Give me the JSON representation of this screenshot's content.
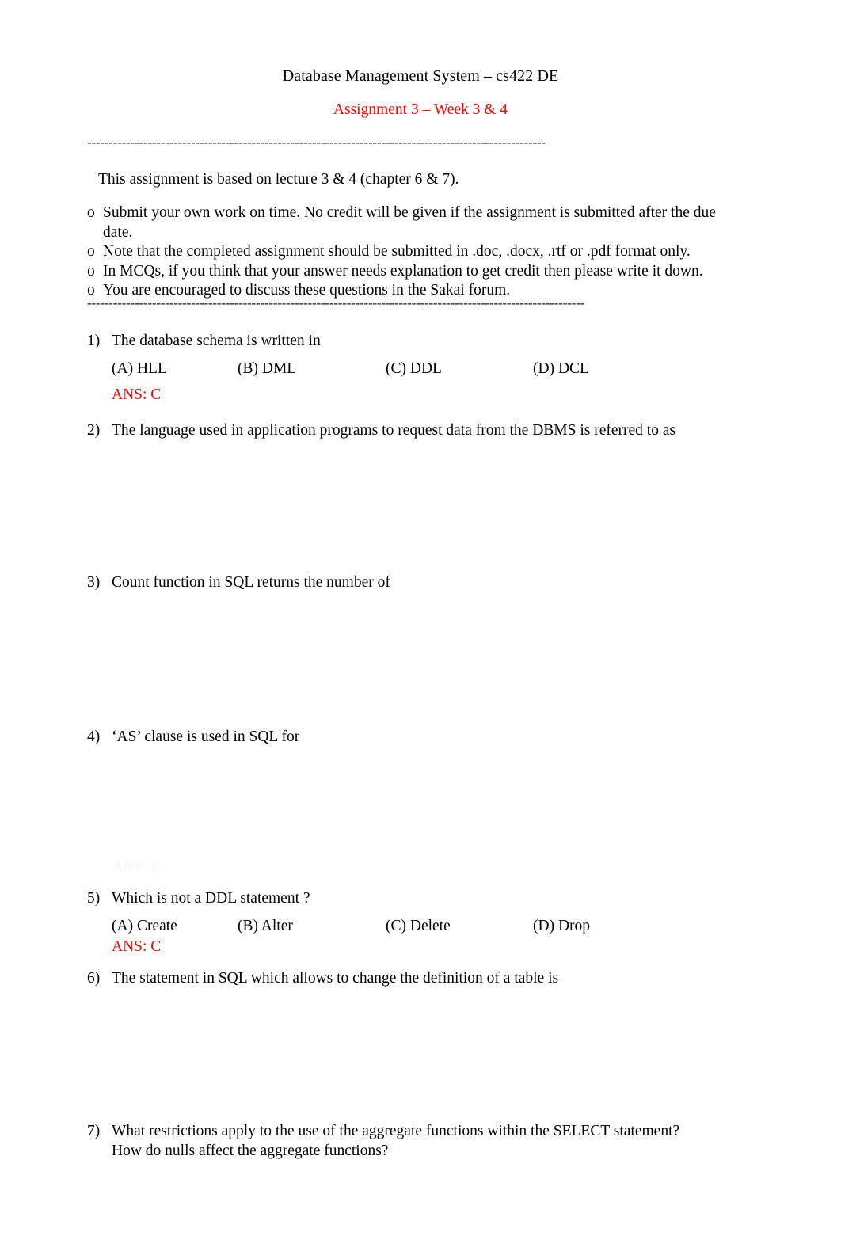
{
  "document": {
    "title": "Database Management System – cs422 DE",
    "subtitle": "Assignment 3 – Week 3 & 4",
    "separator_top": "----------------------------------------------------------------------------------------------------------",
    "separator_bottom": "-------------------------------------------------------------------------------------------------------------------",
    "intro": "This assignment is based on lecture 3 & 4 (chapter 6 & 7).",
    "accent_color": "#FF0000",
    "text_color": "#000000"
  },
  "instructions": {
    "bullet_marker": "o",
    "items": [
      "Submit your  own work  on time. No credit will be given if the assignment is submitted after the due date.",
      "Note that the completed assignment should be submitted in .doc, .docx, .rtf or .pdf format only.",
      "In MCQs, if you think that your answer needs explanation to get credit then please write it down.",
      "You are encouraged to discuss these questions in the Sakai forum."
    ]
  },
  "questions": [
    {
      "number": "1)",
      "text": "The database schema is written in",
      "options": [
        "(A) HLL",
        "(B) DML",
        "(C) DDL",
        "(D) DCL"
      ],
      "answer": "ANS: C"
    },
    {
      "number": "2)",
      "text": "The language used in application programs to request data from the DBMS is referred to as",
      "options": [],
      "answer": ""
    },
    {
      "number": "3)",
      "text": "Count function in SQL returns the number of",
      "options": [],
      "answer": ""
    },
    {
      "number": "4)",
      "text": "‘AS’ clause is used in SQL for",
      "options": [],
      "answer": ""
    },
    {
      "number": "5)",
      "text": "Which is not a DDL statement ?",
      "options": [
        "(A) Create",
        "(B) Alter",
        "(C) Delete",
        "(D) Drop"
      ],
      "answer": "ANS: C"
    },
    {
      "number": "6)",
      "text": "The statement in SQL which allows to change the definition of a table is",
      "options": [],
      "answer": ""
    },
    {
      "number": "7)",
      "text": "What restrictions apply to the use of the aggregate functions within the SELECT statement?",
      "text_line2": "How do nulls affect the aggregate functions?",
      "options": [],
      "answer": ""
    }
  ],
  "faded_text": "ANS: B"
}
